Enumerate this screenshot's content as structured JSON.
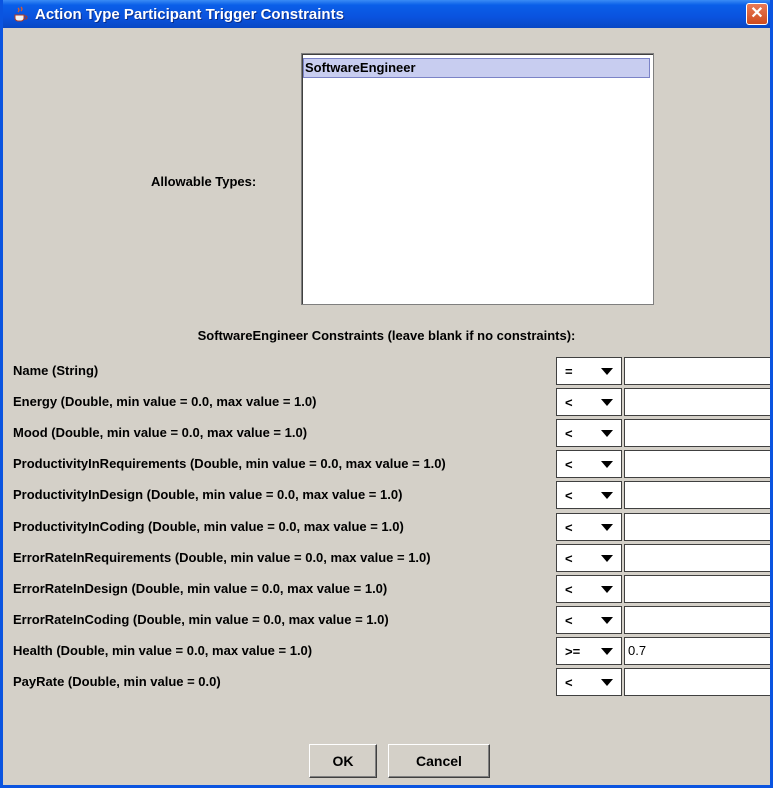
{
  "window": {
    "title": "Action Type Participant Trigger Constraints",
    "close_glyph": "✕"
  },
  "allowable_types": {
    "label": "Allowable Types:",
    "items": [
      "SoftwareEngineer"
    ],
    "selected": "SoftwareEngineer"
  },
  "constraints": {
    "heading": "SoftwareEngineer Constraints  (leave blank if no constraints):",
    "rows": [
      {
        "label": "Name (String)",
        "operator": "=",
        "value": ""
      },
      {
        "label": "Energy (Double, min value = 0.0, max value = 1.0)",
        "operator": "<",
        "value": ""
      },
      {
        "label": "Mood (Double, min value = 0.0, max value = 1.0)",
        "operator": "<",
        "value": ""
      },
      {
        "label": "ProductivityInRequirements (Double, min value = 0.0, max value = 1.0)",
        "operator": "<",
        "value": ""
      },
      {
        "label": "ProductivityInDesign (Double, min value = 0.0, max value = 1.0)",
        "operator": "<",
        "value": ""
      },
      {
        "label": "ProductivityInCoding (Double, min value = 0.0, max value = 1.0)",
        "operator": "<",
        "value": ""
      },
      {
        "label": "ErrorRateInRequirements (Double, min value = 0.0, max value = 1.0)",
        "operator": "<",
        "value": ""
      },
      {
        "label": "ErrorRateInDesign (Double, min value = 0.0, max value = 1.0)",
        "operator": "<",
        "value": ""
      },
      {
        "label": "ErrorRateInCoding (Double, min value = 0.0, max value = 1.0)",
        "operator": "<",
        "value": ""
      },
      {
        "label": "Health (Double, min value = 0.0, max value = 1.0)",
        "operator": ">=",
        "value": "0.7"
      },
      {
        "label": "PayRate (Double, min value = 0.0)",
        "operator": "<",
        "value": ""
      }
    ]
  },
  "buttons": {
    "ok_label": "OK",
    "cancel_label": "Cancel"
  },
  "colors": {
    "titlebar": "#0a53df",
    "dialog_bg": "#d4d0c8",
    "selection": "#c8cdf0"
  },
  "icons": {
    "window_icon": "java-coffee-cup-icon",
    "close": "close-icon",
    "dropdown": "chevron-down-icon"
  }
}
